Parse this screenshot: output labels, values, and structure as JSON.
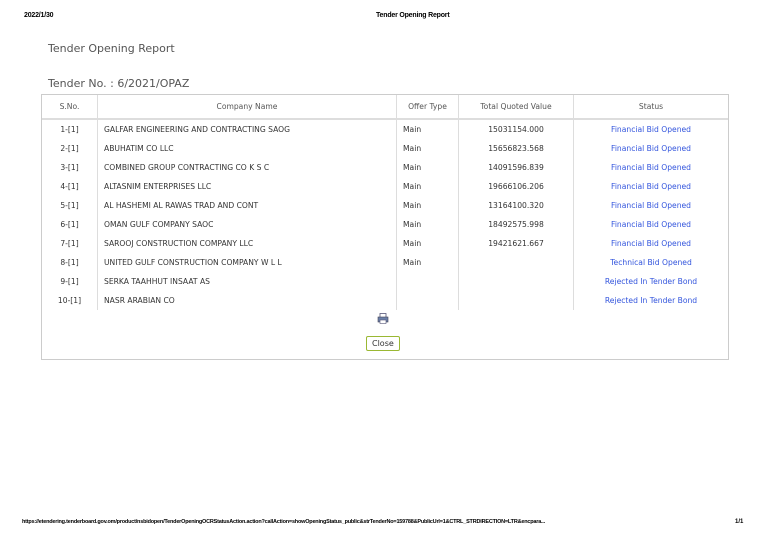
{
  "print_header": {
    "date": "2022/1/30",
    "title": "Tender Opening Report"
  },
  "report_title": "Tender Opening Report",
  "tender_no": "Tender No. : 6/2021/OPAZ",
  "columns": [
    "S.No.",
    "Company Name",
    "Offer Type",
    "Total Quoted Value",
    "Status"
  ],
  "rows": [
    [
      "1-[1]",
      "GALFAR ENGINEERING AND CONTRACTING SAOG",
      "Main",
      "15031154.000",
      "Financial Bid Opened"
    ],
    [
      "2-[1]",
      "ABUHATIM CO LLC",
      "Main",
      "15656823.568",
      "Financial Bid Opened"
    ],
    [
      "3-[1]",
      "COMBINED GROUP CONTRACTING CO K S C",
      "Main",
      "14091596.839",
      "Financial Bid Opened"
    ],
    [
      "4-[1]",
      "ALTASNIM ENTERPRISES LLC",
      "Main",
      "19666106.206",
      "Financial Bid Opened"
    ],
    [
      "5-[1]",
      "AL HASHEMI AL RAWAS TRAD AND CONT",
      "Main",
      "13164100.320",
      "Financial Bid Opened"
    ],
    [
      "6-[1]",
      "OMAN GULF COMPANY SAOC",
      "Main",
      "18492575.998",
      "Financial Bid Opened"
    ],
    [
      "7-[1]",
      "SAROOJ CONSTRUCTION COMPANY LLC",
      "Main",
      "19421621.667",
      "Financial Bid Opened"
    ],
    [
      "8-[1]",
      "UNITED GULF CONSTRUCTION COMPANY W L L",
      "Main",
      "",
      "Technical Bid Opened"
    ],
    [
      "9-[1]",
      "SERKA TAAHHUT INSAAT AS",
      "",
      "",
      "Rejected In Tender Bond"
    ],
    [
      "10-[1]",
      "NASR ARABIAN CO",
      "",
      "",
      "Rejected In Tender Bond"
    ]
  ],
  "close_label": "Close",
  "footer": {
    "url": "https://etendering.tenderboard.gov.om/product/nsbidopen/TenderOpeningOCRStatusAction.action?callAction=showOpeningStatus_public&strTenderNo=159788&PublicUrl=1&CTRL_STRDIRECTION=LTR&encpara...",
    "page": "1/1"
  }
}
